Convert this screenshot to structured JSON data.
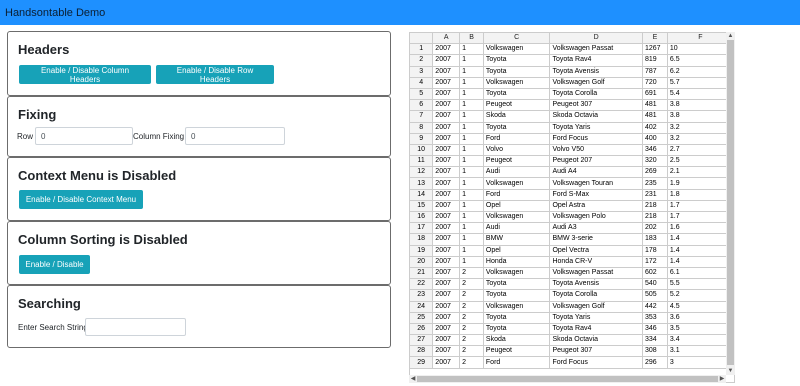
{
  "app": {
    "title": "Handsontable Demo"
  },
  "headers_panel": {
    "title": "Headers",
    "col_headers_btn": "Enable / Disable Column Headers",
    "row_headers_btn": "Enable / Disable Row Headers"
  },
  "fixing_panel": {
    "title": "Fixing",
    "row_label": "Row",
    "row_value": "0",
    "col_label": "Column Fixing",
    "col_value": "0"
  },
  "context_panel": {
    "title": "Context Menu is Disabled",
    "btn": "Enable / Disable Context Menu"
  },
  "sorting_panel": {
    "title": "Column Sorting is Disabled",
    "btn": "Enable / Disable"
  },
  "search_panel": {
    "title": "Searching",
    "label": "Enter Search String",
    "value": ""
  },
  "grid": {
    "columns": [
      "A",
      "B",
      "C",
      "D",
      "E",
      "F"
    ],
    "rows": [
      [
        "2007",
        "1",
        "Volkswagen",
        "Volkswagen Passat",
        "1267",
        "10"
      ],
      [
        "2007",
        "1",
        "Toyota",
        "Toyota Rav4",
        "819",
        "6.5"
      ],
      [
        "2007",
        "1",
        "Toyota",
        "Toyota Avensis",
        "787",
        "6.2"
      ],
      [
        "2007",
        "1",
        "Volkswagen",
        "Volkswagen Golf",
        "720",
        "5.7"
      ],
      [
        "2007",
        "1",
        "Toyota",
        "Toyota Corolla",
        "691",
        "5.4"
      ],
      [
        "2007",
        "1",
        "Peugeot",
        "Peugeot 307",
        "481",
        "3.8"
      ],
      [
        "2007",
        "1",
        "Skoda",
        "Skoda Octavia",
        "481",
        "3.8"
      ],
      [
        "2007",
        "1",
        "Toyota",
        "Toyota Yaris",
        "402",
        "3.2"
      ],
      [
        "2007",
        "1",
        "Ford",
        "Ford Focus",
        "400",
        "3.2"
      ],
      [
        "2007",
        "1",
        "Volvo",
        "Volvo V50",
        "346",
        "2.7"
      ],
      [
        "2007",
        "1",
        "Peugeot",
        "Peugeot 207",
        "320",
        "2.5"
      ],
      [
        "2007",
        "1",
        "Audi",
        "Audi A4",
        "269",
        "2.1"
      ],
      [
        "2007",
        "1",
        "Volkswagen",
        "Volkswagen Touran",
        "235",
        "1.9"
      ],
      [
        "2007",
        "1",
        "Ford",
        "Ford S-Max",
        "231",
        "1.8"
      ],
      [
        "2007",
        "1",
        "Opel",
        "Opel Astra",
        "218",
        "1.7"
      ],
      [
        "2007",
        "1",
        "Volkswagen",
        "Volkswagen Polo",
        "218",
        "1.7"
      ],
      [
        "2007",
        "1",
        "Audi",
        "Audi A3",
        "202",
        "1.6"
      ],
      [
        "2007",
        "1",
        "BMW",
        "BMW 3-serie",
        "183",
        "1.4"
      ],
      [
        "2007",
        "1",
        "Opel",
        "Opel Vectra",
        "178",
        "1.4"
      ],
      [
        "2007",
        "1",
        "Honda",
        "Honda CR-V",
        "172",
        "1.4"
      ],
      [
        "2007",
        "2",
        "Volkswagen",
        "Volkswagen Passat",
        "602",
        "6.1"
      ],
      [
        "2007",
        "2",
        "Toyota",
        "Toyota Avensis",
        "540",
        "5.5"
      ],
      [
        "2007",
        "2",
        "Toyota",
        "Toyota Corolla",
        "505",
        "5.2"
      ],
      [
        "2007",
        "2",
        "Volkswagen",
        "Volkswagen Golf",
        "442",
        "4.5"
      ],
      [
        "2007",
        "2",
        "Toyota",
        "Toyota Yaris",
        "353",
        "3.6"
      ],
      [
        "2007",
        "2",
        "Toyota",
        "Toyota Rav4",
        "346",
        "3.5"
      ],
      [
        "2007",
        "2",
        "Skoda",
        "Skoda Octavia",
        "334",
        "3.4"
      ],
      [
        "2007",
        "2",
        "Peugeot",
        "Peugeot 307",
        "308",
        "3.1"
      ],
      [
        "2007",
        "2",
        "Ford",
        "Ford Focus",
        "296",
        "3"
      ]
    ]
  },
  "colors": {
    "topbar": "#1e90ff",
    "button": "#17a2b8"
  }
}
